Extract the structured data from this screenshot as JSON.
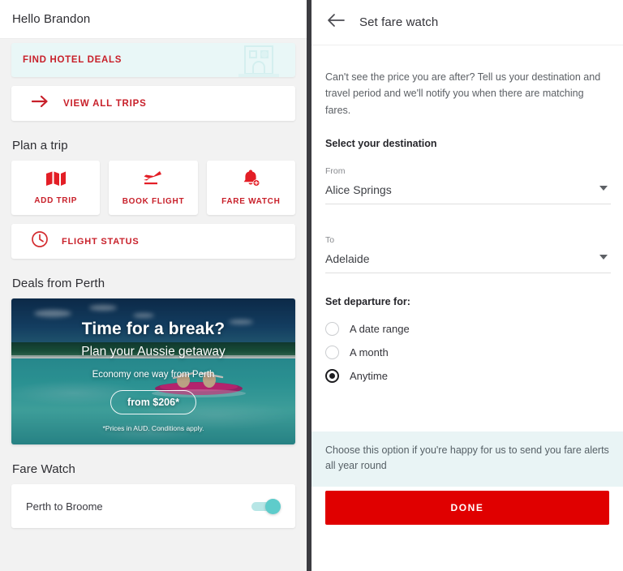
{
  "left": {
    "header": {
      "greeting": "Hello Brandon"
    },
    "hotel_card": {
      "label": "FIND HOTEL DEALS",
      "icon": "hotel-building-icon"
    },
    "view_all_trips": {
      "label": "VIEW ALL TRIPS",
      "icon": "arrow-right-icon"
    },
    "plan_a_trip": {
      "title": "Plan a trip",
      "tiles": [
        {
          "label": "ADD TRIP",
          "icon": "map-icon"
        },
        {
          "label": "BOOK FLIGHT",
          "icon": "airplane-icon"
        },
        {
          "label": "FARE WATCH",
          "icon": "bell-plus-icon"
        }
      ],
      "flight_status": {
        "label": "FLIGHT STATUS",
        "icon": "clock-icon"
      }
    },
    "deals": {
      "title": "Deals from Perth",
      "promo": {
        "headline": "Time for a break?",
        "subhead": "Plan your Aussie getaway",
        "description": "Economy one way from Perth",
        "price_pill": "from $206*",
        "fine_print": "*Prices in AUD. Conditions apply."
      }
    },
    "fare_watch": {
      "title": "Fare Watch",
      "items": [
        {
          "route": "Perth to Broome",
          "enabled": true
        }
      ]
    }
  },
  "right": {
    "header": {
      "title": "Set fare watch",
      "back_icon": "arrow-left-icon"
    },
    "intro": "Can't see the price you are after? Tell us your destination and travel period and we'll notify you when there are matching fares.",
    "select_destination_label": "Select your destination",
    "from_field": {
      "label": "From",
      "value": "Alice Springs",
      "caret_icon": "chevron-down-icon"
    },
    "to_field": {
      "label": "To",
      "value": "Adelaide",
      "caret_icon": "chevron-down-icon"
    },
    "departure": {
      "label": "Set departure for:",
      "options": [
        {
          "label": "A date range",
          "selected": false
        },
        {
          "label": "A month",
          "selected": false
        },
        {
          "label": "Anytime",
          "selected": true
        }
      ]
    },
    "info_note": "Choose this option if you're happy for us to send you fare alerts all year round",
    "done_label": "DONE"
  },
  "colors": {
    "brand_red": "#c8202a",
    "button_red": "#e00000",
    "teal_toggle": "#5ecccb",
    "info_bg": "#e9f4f5",
    "hotel_bg": "#e9f7f7"
  }
}
